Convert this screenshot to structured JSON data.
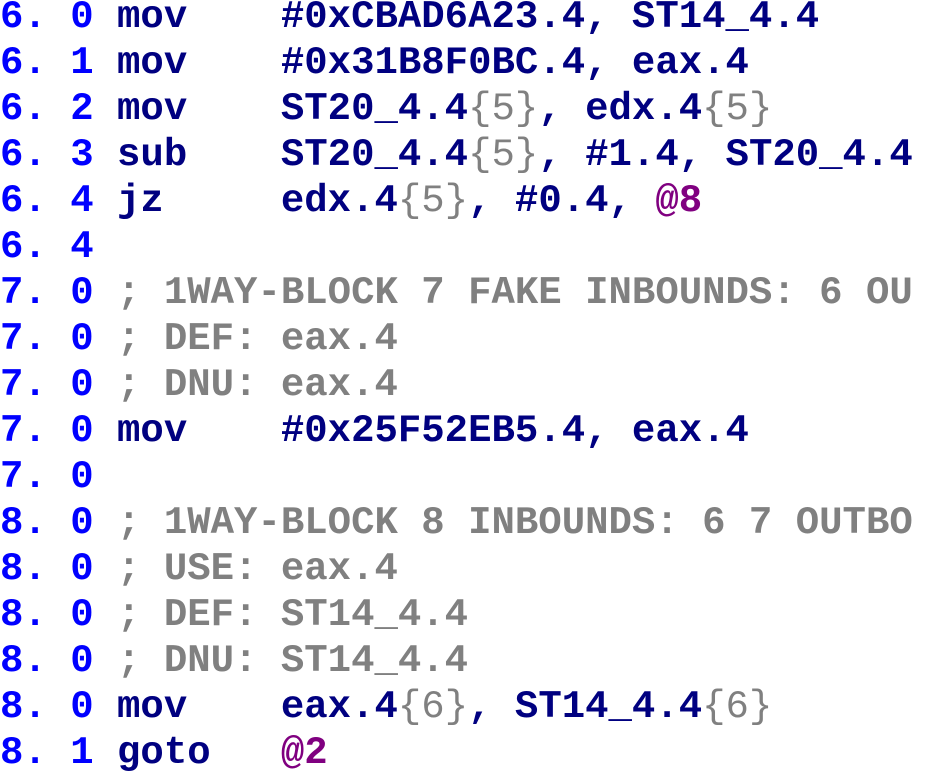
{
  "colors": {
    "line_number": "#0000ff",
    "instruction": "#000080",
    "version": "#808080",
    "label": "#800080",
    "comment": "#808080",
    "background": "#ffffff"
  },
  "lines": [
    {
      "num": "6. 0",
      "kind": "insn",
      "op": "mov",
      "parts": [
        {
          "t": "arg",
          "v": "#0xCBAD6A23.4"
        },
        {
          "t": "arg",
          "v": ", ST14_4.4"
        }
      ]
    },
    {
      "num": "6. 1",
      "kind": "insn",
      "op": "mov",
      "parts": [
        {
          "t": "arg",
          "v": "#0x31B8F0BC.4"
        },
        {
          "t": "arg",
          "v": ", eax.4"
        }
      ]
    },
    {
      "num": "6. 2",
      "kind": "insn",
      "op": "mov",
      "parts": [
        {
          "t": "arg",
          "v": "ST20_4.4"
        },
        {
          "t": "ver",
          "v": "{5}"
        },
        {
          "t": "arg",
          "v": ", edx.4"
        },
        {
          "t": "ver",
          "v": "{5}"
        }
      ]
    },
    {
      "num": "6. 3",
      "kind": "insn",
      "op": "sub",
      "parts": [
        {
          "t": "arg",
          "v": "ST20_4.4"
        },
        {
          "t": "ver",
          "v": "{5}"
        },
        {
          "t": "arg",
          "v": ", #1.4, ST20_4.4"
        }
      ]
    },
    {
      "num": "6. 4",
      "kind": "insn",
      "op": "jz",
      "parts": [
        {
          "t": "arg",
          "v": "edx.4"
        },
        {
          "t": "ver",
          "v": "{5}"
        },
        {
          "t": "arg",
          "v": ", #0.4, "
        },
        {
          "t": "lbl",
          "v": "@8"
        }
      ]
    },
    {
      "num": "6. 4",
      "kind": "empty"
    },
    {
      "num": "7. 0",
      "kind": "comment",
      "text": "; 1WAY-BLOCK 7 FAKE INBOUNDS: 6 OU"
    },
    {
      "num": "7. 0",
      "kind": "comment",
      "text": "; DEF: eax.4"
    },
    {
      "num": "7. 0",
      "kind": "comment",
      "text": "; DNU: eax.4"
    },
    {
      "num": "7. 0",
      "kind": "insn",
      "op": "mov",
      "parts": [
        {
          "t": "arg",
          "v": "#0x25F52EB5.4"
        },
        {
          "t": "arg",
          "v": ", eax.4"
        }
      ]
    },
    {
      "num": "7. 0",
      "kind": "empty"
    },
    {
      "num": "8. 0",
      "kind": "comment",
      "text": "; 1WAY-BLOCK 8 INBOUNDS: 6 7 OUTBO"
    },
    {
      "num": "8. 0",
      "kind": "comment",
      "text": "; USE: eax.4"
    },
    {
      "num": "8. 0",
      "kind": "comment",
      "text": "; DEF: ST14_4.4"
    },
    {
      "num": "8. 0",
      "kind": "comment",
      "text": "; DNU: ST14_4.4"
    },
    {
      "num": "8. 0",
      "kind": "insn",
      "op": "mov",
      "parts": [
        {
          "t": "arg",
          "v": "eax.4"
        },
        {
          "t": "ver",
          "v": "{6}"
        },
        {
          "t": "arg",
          "v": ", ST14_4.4"
        },
        {
          "t": "ver",
          "v": "{6}"
        }
      ]
    },
    {
      "num": "8. 1",
      "kind": "insn",
      "op": "goto",
      "parts": [
        {
          "t": "lbl",
          "v": "@2"
        }
      ]
    }
  ]
}
